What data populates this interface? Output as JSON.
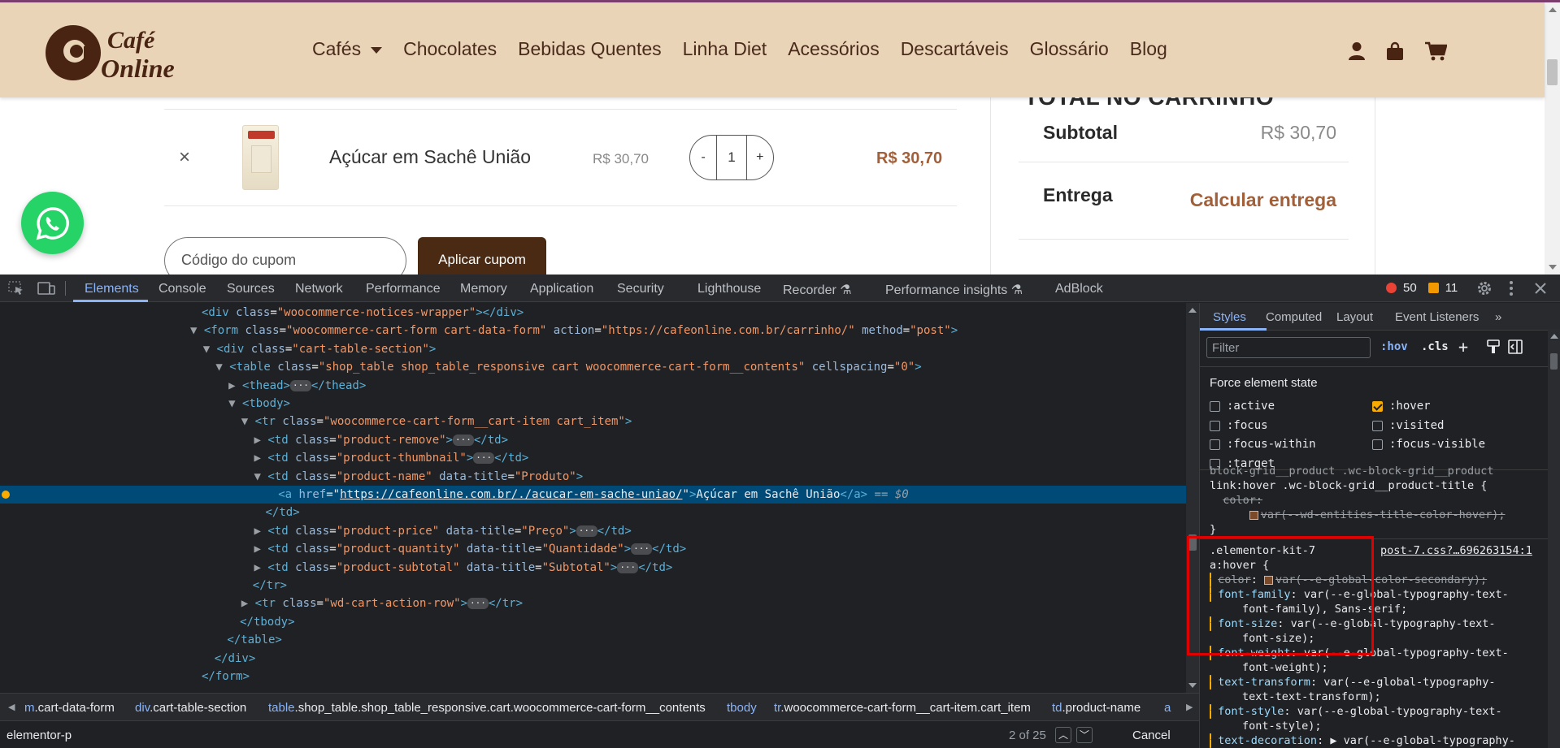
{
  "site": {
    "logo_line1": "Café",
    "logo_line2": "Online",
    "logo_mark": "@",
    "nav": [
      "Cafés",
      "Chocolates",
      "Bebidas Quentes",
      "Linha Diet",
      "Acessórios",
      "Descartáveis",
      "Glossário",
      "Blog"
    ],
    "header_icons": [
      "user-icon",
      "bag-icon",
      "cart-icon"
    ],
    "total_heading": "TOTAL NO CARRINHO",
    "subtotal_label": "Subtotal",
    "subtotal_value": "R$ 30,70",
    "shipping_label": "Entrega",
    "shipping_link": "Calcular entrega",
    "remove_symbol": "×",
    "product_name": "Açúcar em Sachê União",
    "product_price": "R$ 30,70",
    "qty_minus": "-",
    "qty_value": "1",
    "qty_plus": "+",
    "product_subtotal": "R$ 30,70",
    "coupon_placeholder": "Código do cupom",
    "apply_button": "Aplicar cupom",
    "colors": {
      "header_bg": "#e9d4b8",
      "brand_brown": "#4a2a12",
      "accent": "#a1603a",
      "whatsapp": "#25d366"
    }
  },
  "devtools": {
    "tabs": [
      "Elements",
      "Console",
      "Sources",
      "Network",
      "Performance",
      "Memory",
      "Application",
      "Security",
      "Lighthouse",
      "Recorder",
      "Performance insights",
      "AdBlock"
    ],
    "active_tab": "Elements",
    "errors": "50",
    "warnings": "11",
    "dom": [
      {
        "indent": 0,
        "tri": "",
        "open": "<div",
        "attrs": [
          [
            "class",
            "woocommerce-notices-wrapper"
          ]
        ],
        "tail": "></div>"
      },
      {
        "indent": 0,
        "tri": "▼",
        "open": "<form",
        "attrs": [
          [
            "class",
            "woocommerce-cart-form cart-data-form"
          ],
          [
            "action",
            "https://cafeonline.com.br/carrinho/"
          ],
          [
            "method",
            "post"
          ]
        ],
        "tail": ">"
      },
      {
        "indent": 1,
        "tri": "▼",
        "open": "<div",
        "attrs": [
          [
            "class",
            "cart-table-section"
          ]
        ],
        "tail": ">"
      },
      {
        "indent": 2,
        "tri": "▼",
        "open": "<table",
        "attrs": [
          [
            "class",
            "shop_table shop_table_responsive cart woocommerce-cart-form__contents"
          ],
          [
            "cellspacing",
            "0"
          ]
        ],
        "tail": ">"
      },
      {
        "indent": 3,
        "tri": "▶",
        "open": "<thead",
        "attrs": [],
        "tail": ">",
        "collapsed": true,
        "close": "</thead>"
      },
      {
        "indent": 3,
        "tri": "▼",
        "open": "<tbody",
        "attrs": [],
        "tail": ">"
      },
      {
        "indent": 4,
        "tri": "▼",
        "open": "<tr",
        "attrs": [
          [
            "class",
            "woocommerce-cart-form__cart-item cart_item"
          ]
        ],
        "tail": ">"
      },
      {
        "indent": 5,
        "tri": "▶",
        "open": "<td",
        "attrs": [
          [
            "class",
            "product-remove"
          ]
        ],
        "tail": ">",
        "collapsed": true,
        "close": "</td>"
      },
      {
        "indent": 5,
        "tri": "▶",
        "open": "<td",
        "attrs": [
          [
            "class",
            "product-thumbnail"
          ]
        ],
        "tail": ">",
        "collapsed": true,
        "close": "</td>"
      },
      {
        "indent": 5,
        "tri": "▼",
        "open": "<td",
        "attrs": [
          [
            "class",
            "product-name"
          ],
          [
            "data-title",
            "Produto"
          ]
        ],
        "tail": ">"
      },
      {
        "indent": 6,
        "tri": "",
        "selected": true,
        "open": "<a",
        "attrs": [
          [
            "href",
            "https://cafeonline.com.br/./acucar-em-sache-uniao/"
          ]
        ],
        "tail": ">",
        "text": "Açúcar em Sachê União",
        "close": "</a>",
        "eq": " == $0"
      },
      {
        "indent": 5,
        "tri": "",
        "open": "</td>",
        "attrs": [],
        "tail": ""
      },
      {
        "indent": 5,
        "tri": "▶",
        "open": "<td",
        "attrs": [
          [
            "class",
            "product-price"
          ],
          [
            "data-title",
            "Preço"
          ]
        ],
        "tail": ">",
        "collapsed": true,
        "close": "</td>"
      },
      {
        "indent": 5,
        "tri": "▶",
        "open": "<td",
        "attrs": [
          [
            "class",
            "product-quantity"
          ],
          [
            "data-title",
            "Quantidade"
          ]
        ],
        "tail": ">",
        "collapsed": true,
        "close": "</td>"
      },
      {
        "indent": 5,
        "tri": "▶",
        "open": "<td",
        "attrs": [
          [
            "class",
            "product-subtotal"
          ],
          [
            "data-title",
            "Subtotal"
          ]
        ],
        "tail": ">",
        "collapsed": true,
        "close": "</td>"
      },
      {
        "indent": 4,
        "tri": "",
        "open": "</tr>",
        "attrs": [],
        "tail": ""
      },
      {
        "indent": 4,
        "tri": "▶",
        "open": "<tr",
        "attrs": [
          [
            "class",
            "wd-cart-action-row"
          ]
        ],
        "tail": ">",
        "collapsed": true,
        "close": "</tr>"
      },
      {
        "indent": 3,
        "tri": "",
        "open": "</tbody>",
        "attrs": [],
        "tail": ""
      },
      {
        "indent": 2,
        "tri": "",
        "open": "</table>",
        "attrs": [],
        "tail": ""
      },
      {
        "indent": 1,
        "tri": "",
        "open": "</div>",
        "attrs": [],
        "tail": ""
      },
      {
        "indent": 0,
        "tri": "",
        "open": "</form>",
        "attrs": [],
        "tail": ""
      }
    ],
    "breadcrumbs": [
      {
        "pre": "m",
        "rest": ".cart-data-form"
      },
      {
        "pre": "div",
        "rest": ".cart-table-section"
      },
      {
        "pre": "table",
        "rest": ".shop_table.shop_table_responsive.cart.woocommerce-cart-form__contents"
      },
      {
        "pre": "tbody",
        "rest": ""
      },
      {
        "pre": "tr",
        "rest": ".woocommerce-cart-form__cart-item.cart_item"
      },
      {
        "pre": "td",
        "rest": ".product-name"
      },
      {
        "pre": "a",
        "rest": ""
      }
    ],
    "search": {
      "value": "elementor-p",
      "count": "2 of 25",
      "cancel": "Cancel"
    },
    "styles": {
      "tabs": [
        "Styles",
        "Computed",
        "Layout",
        "Event Listeners"
      ],
      "filter_placeholder": "Filter",
      "hov": ":hov",
      "cls": ".cls",
      "force_title": "Force element state",
      "states": [
        {
          "label": ":active",
          "checked": false
        },
        {
          "label": ":hover",
          "checked": true
        },
        {
          "label": ":focus",
          "checked": false
        },
        {
          "label": ":visited",
          "checked": false
        },
        {
          "label": ":focus-within",
          "checked": false
        },
        {
          "label": ":focus-visible",
          "checked": false
        },
        {
          "label": ":target",
          "checked": false
        }
      ],
      "rule1_selector_a": "block-grid__product .wc-block-grid__product",
      "rule1_selector_b": "link:hover .wc-block-grid__product-title {",
      "rule1_prop": "color:",
      "rule1_value": "var(--wd-entities-title-color-hover);",
      "rule_close": "}",
      "rule2_selector_a": ".elementor-kit-7",
      "rule2_selector_b": "a:hover {",
      "rule2_source": "post-7.css?…696263154:1",
      "props": [
        {
          "name": "color",
          "value": "var(--e-global-color-secondary);",
          "cont": "",
          "struck": true,
          "swatch": true
        },
        {
          "name": "font-family",
          "value": "var(--e-global-typography-text-",
          "cont": "font-family), Sans-serif;",
          "struck": false
        },
        {
          "name": "font-size",
          "value": "var(--e-global-typography-text-",
          "cont": "font-size);",
          "struck": false
        },
        {
          "name": "font-weight",
          "value": "var(--e-global-typography-text-",
          "cont": "font-weight);",
          "struck": false
        },
        {
          "name": "text-transform",
          "value": "var(--e-global-typography-",
          "cont": "text-text-transform);",
          "struck": false
        },
        {
          "name": "font-style",
          "value": "var(--e-global-typography-text-",
          "cont": "font-style);",
          "struck": false
        },
        {
          "name": "text-decoration",
          "value": "▶ var(--e-global-typography-",
          "cont": "",
          "struck": false
        }
      ]
    }
  }
}
